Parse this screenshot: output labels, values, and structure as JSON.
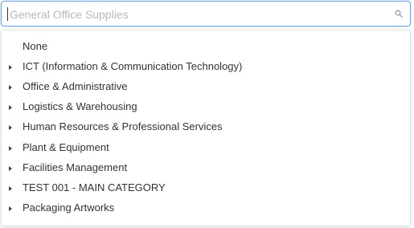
{
  "search": {
    "placeholder": "General Office Supplies",
    "icon": "search-icon"
  },
  "dropdown": {
    "options": [
      {
        "label": "None",
        "has_children": false
      },
      {
        "label": "ICT (Information & Communication Technology)",
        "has_children": true
      },
      {
        "label": "Office & Administrative",
        "has_children": true
      },
      {
        "label": "Logistics & Warehousing",
        "has_children": true
      },
      {
        "label": "Human Resources & Professional Services",
        "has_children": true
      },
      {
        "label": "Plant & Equipment",
        "has_children": true
      },
      {
        "label": "Facilities Management",
        "has_children": true
      },
      {
        "label": "TEST 001 - MAIN CATEGORY",
        "has_children": true
      },
      {
        "label": "Packaging Artworks",
        "has_children": true
      }
    ]
  },
  "colors": {
    "focus_border": "#6aa3e0",
    "placeholder": "#b4b8be",
    "text": "#333333",
    "caret": "#444444"
  }
}
